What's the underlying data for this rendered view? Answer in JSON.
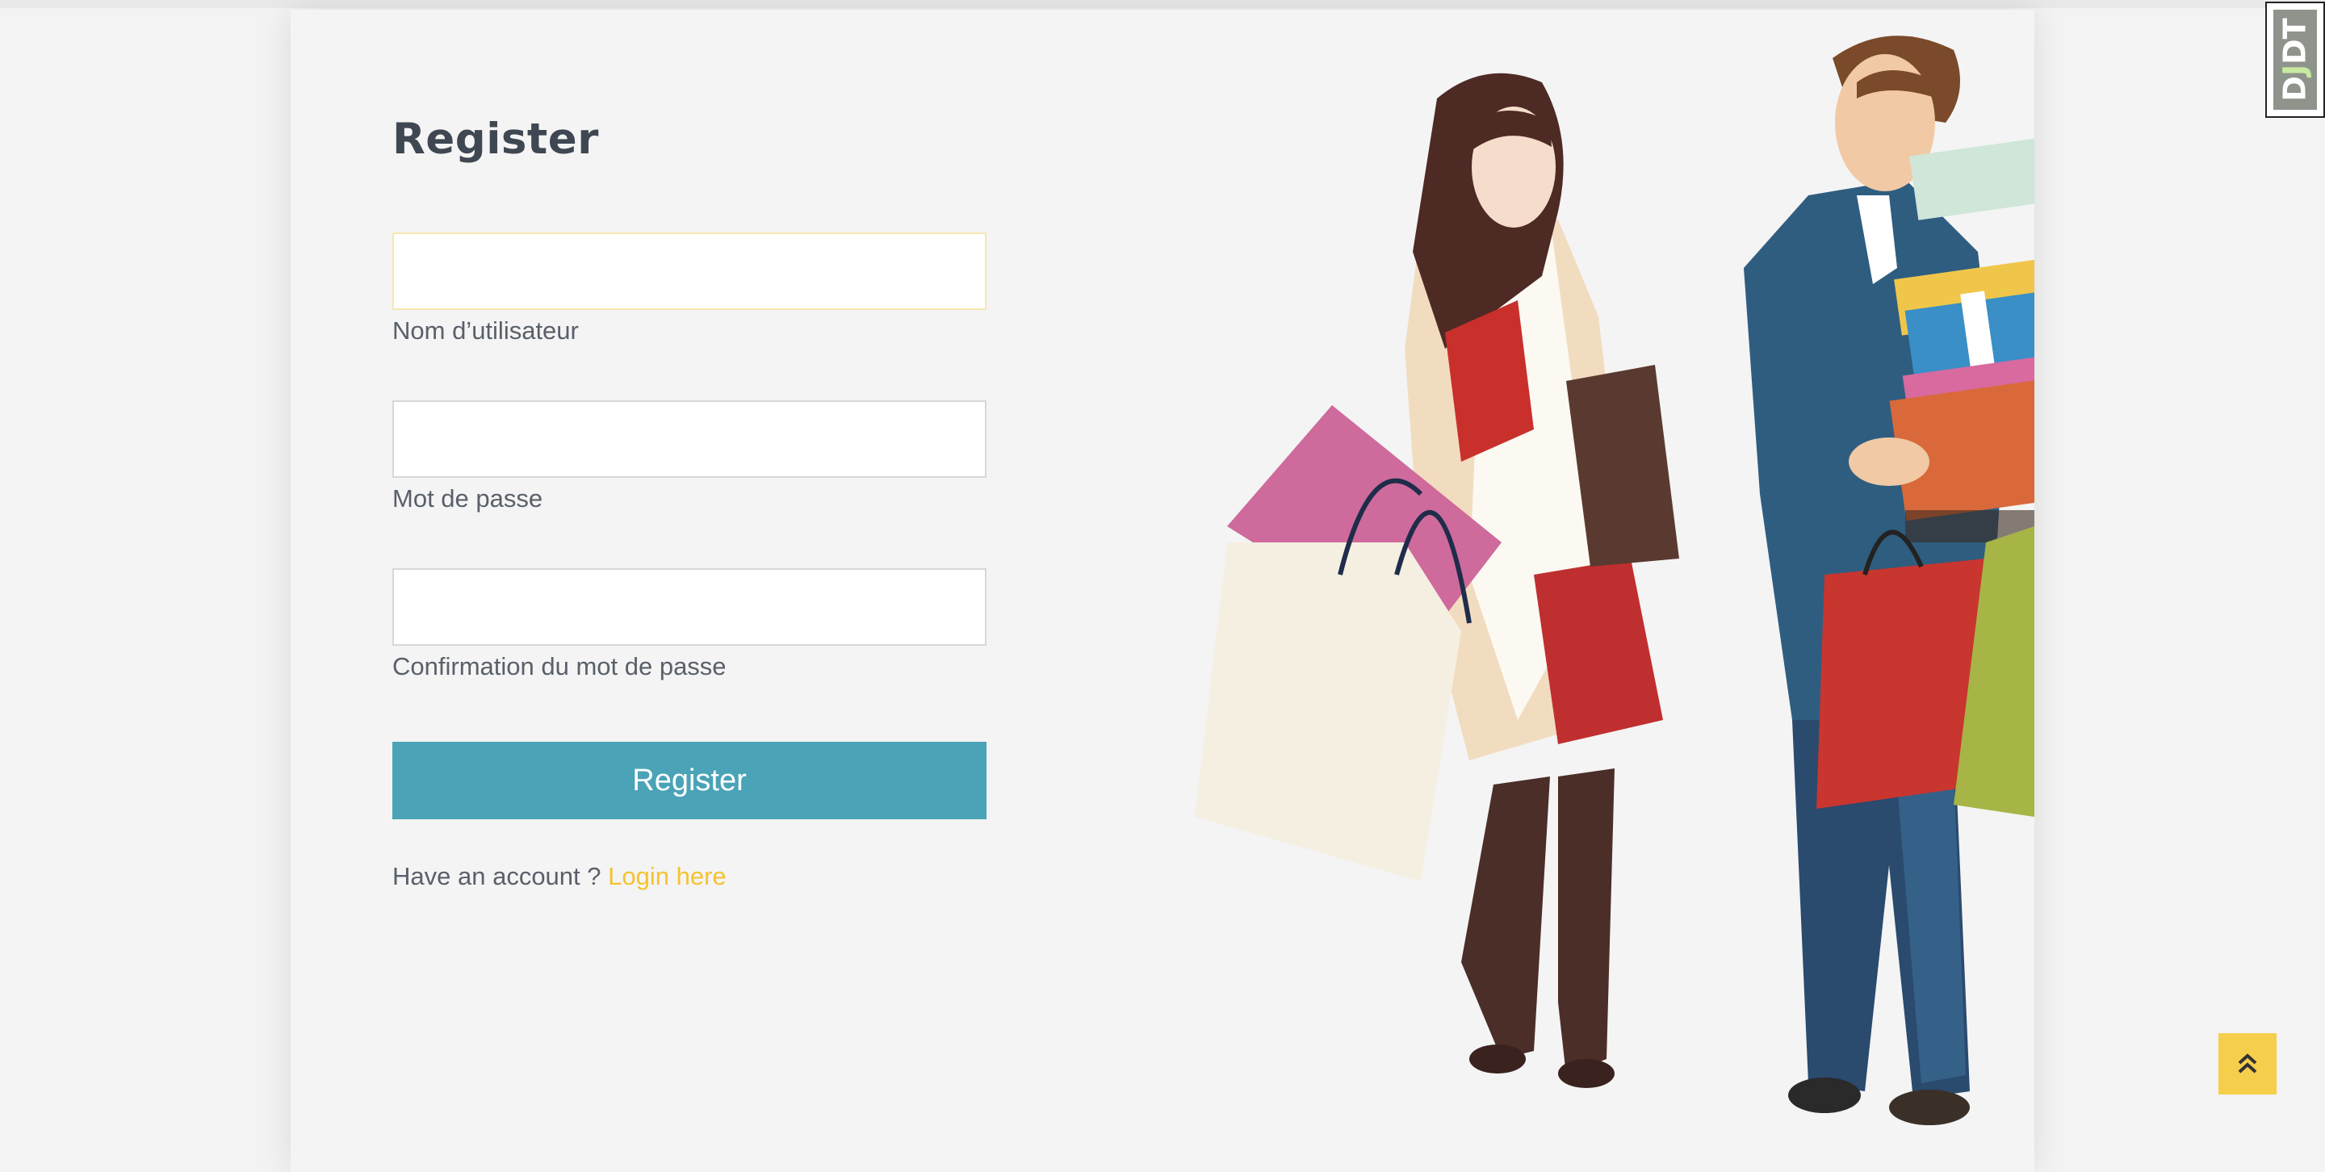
{
  "page": {
    "title": "Register"
  },
  "form": {
    "username_label": "Nom d’utilisateur",
    "username_value": "",
    "password_label": "Mot de passe",
    "password_value": "",
    "confirm_label": "Confirmation du mot de passe",
    "confirm_value": "",
    "submit_label": "Register"
  },
  "footer": {
    "have_account_text": "Have an account ? ",
    "login_link": "Login here"
  },
  "debug_toolbar": {
    "label_d": "D",
    "label_j": "J",
    "label_dt": "DT"
  },
  "icons": {
    "scroll_top": "double-chevron-up-icon",
    "illustration": "shopping-couple-illustration"
  },
  "colors": {
    "accent": "#4aa3b7",
    "link": "#f5c330",
    "scroll_button": "#f5cf4b",
    "text": "#5a606a",
    "heading": "#3f4752"
  }
}
